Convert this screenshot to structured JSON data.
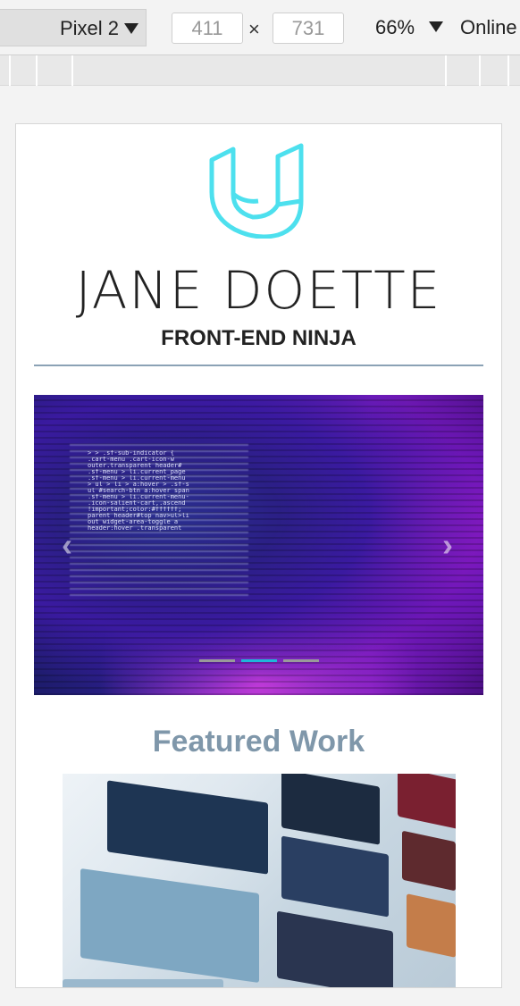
{
  "devtools": {
    "device": "Pixel 2",
    "width": "411",
    "height": "731",
    "dimension_separator": "×",
    "zoom": "66%",
    "network": "Online"
  },
  "page": {
    "name": "JANE DOETTE",
    "subtitle": "FRONT-END NINJA",
    "carousel": {
      "prev_glyph": "‹",
      "next_glyph": "›",
      "indicators": 3,
      "active_index": 1,
      "code_text": [
        "> > .sf-sub-indicator {",
        "  .cart-menu .cart-icon-w",
        "  outer.transparent header#",
        "  .sf-menu > li.current_page",
        "  .sf-menu > li.current-menu",
        "  > ul > li > a:hover > .sf-s",
        "  ul #search-btn a:hover span",
        "  .sf-menu > li.current-menu-",
        "  .icon-salient-cart,.ascend",
        "  !important;color:#ffffff;",
        "  parent header#top nav>ul>li",
        "  out widget-area-toggle a",
        "  header:hover .transparent"
      ]
    },
    "featured_heading": "Featured Work"
  },
  "colors": {
    "logo": "#4de0ee",
    "rule": "#8ba2b5",
    "featured": "#7f97aa",
    "indicator_active": "#1fb6da",
    "indicator": "#9a9a9a"
  }
}
